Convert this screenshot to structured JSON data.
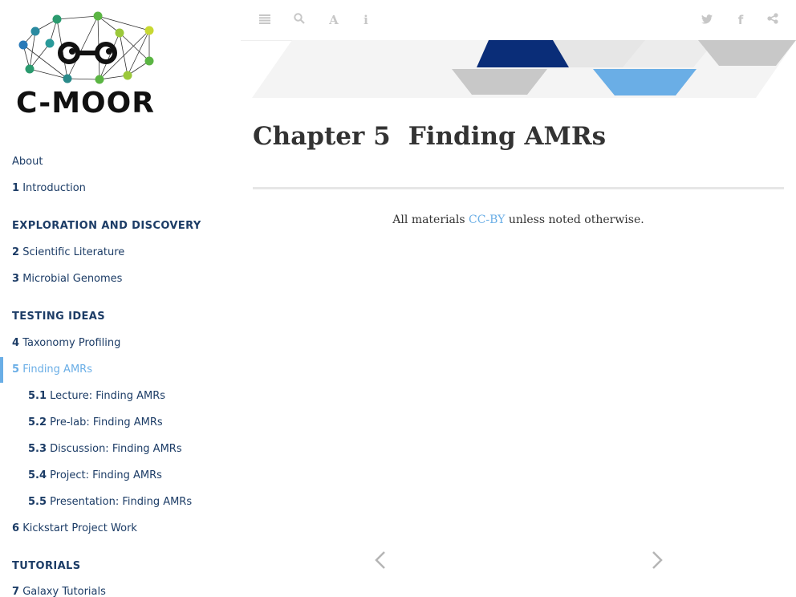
{
  "logo": {
    "text": "C-MOOR"
  },
  "toolbar": {
    "icons": [
      "list-icon",
      "search-icon",
      "font-icon",
      "info-icon",
      "twitter-icon",
      "facebook-icon",
      "share-icon"
    ],
    "search_glyph": "⌕",
    "font_glyph": "A",
    "info_glyph": "i",
    "twitter_glyph": "🐦",
    "facebook_glyph": "f",
    "share_glyph": "⋖"
  },
  "sidebar": {
    "about": "About",
    "items": [
      {
        "num": "1",
        "label": "Introduction"
      },
      {
        "part": "EXPLORATION AND DISCOVERY"
      },
      {
        "num": "2",
        "label": "Scientific Literature"
      },
      {
        "num": "3",
        "label": "Microbial Genomes"
      },
      {
        "part": "TESTING IDEAS"
      },
      {
        "num": "4",
        "label": "Taxonomy Profiling"
      },
      {
        "num": "5",
        "label": "Finding AMRs",
        "active": true
      },
      {
        "num": "5.1",
        "label": "Lecture: Finding AMRs"
      },
      {
        "num": "5.2",
        "label": "Pre-lab: Finding AMRs"
      },
      {
        "num": "5.3",
        "label": "Discussion: Finding AMRs"
      },
      {
        "num": "5.4",
        "label": "Project: Finding AMRs"
      },
      {
        "num": "5.5",
        "label": "Presentation: Finding AMRs"
      },
      {
        "num": "6",
        "label": "Kickstart Project Work"
      },
      {
        "part": "TUTORIALS"
      },
      {
        "num": "7",
        "label": "Galaxy Tutorials"
      }
    ]
  },
  "main": {
    "chapter_number": "Chapter 5",
    "chapter_title": "Finding AMRs",
    "license_prefix": "All materials ",
    "license_link": "CC-BY",
    "license_suffix": " unless noted otherwise."
  },
  "colors": {
    "nav_text": "#1c3c66",
    "active": "#6aaee6",
    "banner_dark": "#0a2d78",
    "banner_light_blue": "#6aaee6",
    "banner_gray": "#c8c8c8"
  }
}
